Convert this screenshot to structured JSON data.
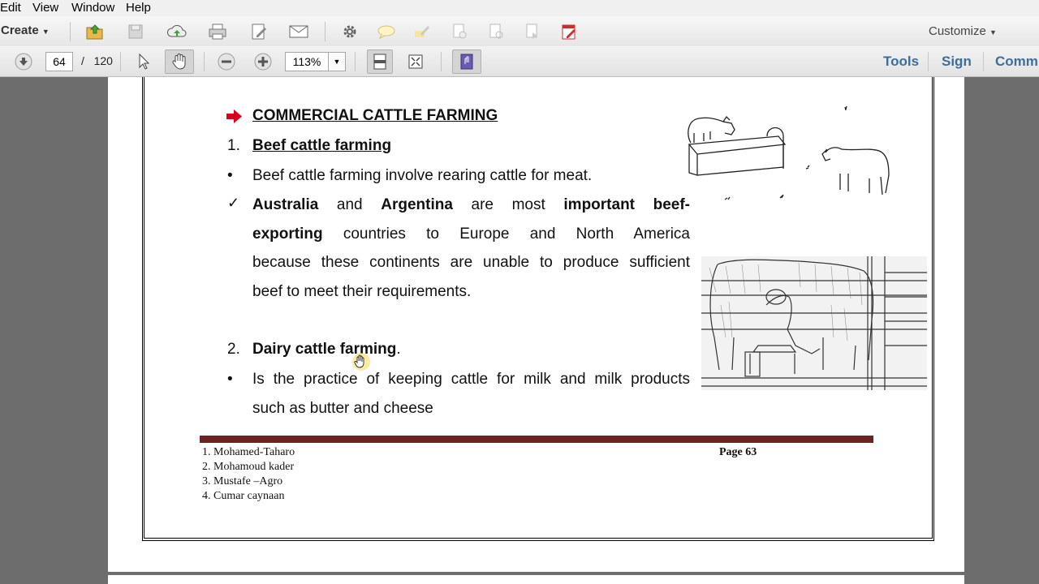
{
  "menu": {
    "edit": "Edit",
    "view": "View",
    "window": "Window",
    "help": "Help"
  },
  "toolbar": {
    "create": "Create",
    "customize": "Customize"
  },
  "nav": {
    "current_page": "64",
    "separator": "/",
    "total_pages": "120",
    "zoom": "113%"
  },
  "panes": {
    "tools": "Tools",
    "sign": "Sign",
    "comment": "Comm"
  },
  "doc": {
    "heading": "COMMERCIAL CATTLE FARMING",
    "num1": "1.",
    "sub1": "Beef cattle farming",
    "bullet1": "Beef cattle farming involve rearing cattle for meat.",
    "check_line1_a": "Australia",
    "check_line1_b": "and",
    "check_line1_c": "Argentina",
    "check_line1_d": "are",
    "check_line1_e": "most",
    "check_line1_f": "important beef-",
    "check_line2_a": "exporting",
    "check_line2_b": "countries to Europe and North America",
    "check_line3": "because these continents are unable to produce sufficient",
    "check_line4": "beef to meet their requirements.",
    "num2": "2.",
    "sub2": "Dairy cattle farming",
    "sub2_period": ".",
    "bullet2_line1": "Is the practice of keeping cattle for milk and milk products",
    "bullet2_line2": "such as butter and cheese"
  },
  "footer": {
    "names": [
      "1. Mohamed-Taharo",
      "2. Mohamoud kader",
      "3. Mustafe –Agro",
      "4. Cumar caynaan"
    ],
    "page": "Page 63"
  },
  "colors": {
    "accent_red": "#d8001c",
    "footer_bar": "#6b2424",
    "pane_link": "#3f6d99"
  }
}
